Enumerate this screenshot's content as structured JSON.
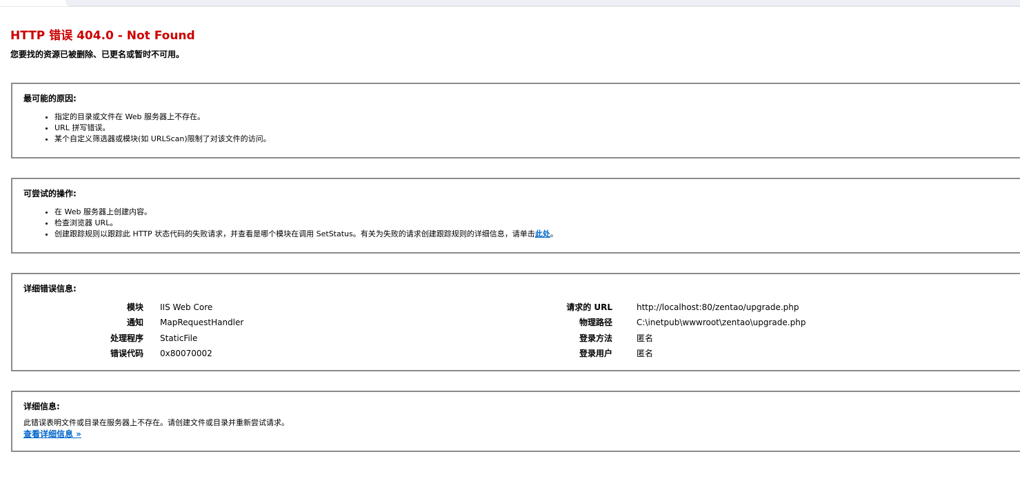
{
  "header": {
    "title": "HTTP 错误 404.0 - Not Found",
    "subtitle": "您要找的资源已被删除、已更名或暂时不可用。"
  },
  "causes": {
    "heading": "最可能的原因:",
    "items": [
      "指定的目录或文件在 Web 服务器上不存在。",
      "URL 拼写错误。",
      "某个自定义筛选器或模块(如 URLScan)限制了对该文件的访问。"
    ]
  },
  "actions": {
    "heading": "可尝试的操作:",
    "items": [
      "在 Web 服务器上创建内容。",
      "检查浏览器 URL。",
      "创建跟踪规则以跟踪此 HTTP 状态代码的失败请求，并查看是哪个模块在调用 SetStatus。有关为失败的请求创建跟踪规则的详细信息，请单击"
    ],
    "link": "此处",
    "link_suffix": "。"
  },
  "details": {
    "heading": "详细错误信息:",
    "left": [
      {
        "label": "模块",
        "value": "IIS Web Core"
      },
      {
        "label": "通知",
        "value": "MapRequestHandler"
      },
      {
        "label": "处理程序",
        "value": "StaticFile"
      },
      {
        "label": "错误代码",
        "value": "0x80070002"
      }
    ],
    "right": [
      {
        "label": "请求的 URL",
        "value": "http://localhost:80/zentao/upgrade.php"
      },
      {
        "label": "物理路径",
        "value": "C:\\inetpub\\wwwroot\\zentao\\upgrade.php"
      },
      {
        "label": "登录方法",
        "value": "匿名"
      },
      {
        "label": "登录用户",
        "value": "匿名"
      }
    ]
  },
  "more": {
    "heading": "详细信息:",
    "text": "此错误表明文件或目录在服务器上不存在。请创建文件或目录并重新尝试请求。",
    "link": "查看详细信息 »"
  }
}
